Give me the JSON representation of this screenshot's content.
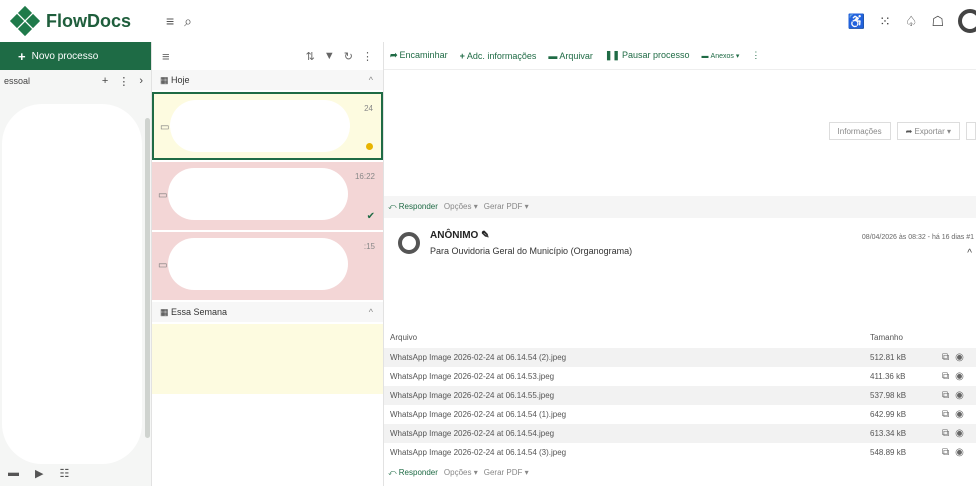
{
  "app": {
    "name": "FlowDocs"
  },
  "sidebar": {
    "new_process": "Novo processo",
    "section": "essoal"
  },
  "list": {
    "groups": [
      {
        "label": "Hoje"
      },
      {
        "label": "Essa Semana"
      }
    ],
    "cards": [
      {
        "time": "24"
      },
      {
        "time": "16:22"
      },
      {
        "time": ":15"
      }
    ]
  },
  "toolbar": {
    "forward": "Encaminhar",
    "add_info": "Adc. informações",
    "archive": "Arquivar",
    "pause": "Pausar processo",
    "attachments": "Anexos"
  },
  "detail": {
    "info_btn": "Informações",
    "export_btn": "Exportar",
    "reply": "Responder",
    "options": "Opções",
    "pdf": "Gerar PDF",
    "sender": "ANÔNIMO",
    "recipient": "Para Ouvidoria Geral do Município (Organograma)",
    "date": "08/04/2026 às 08:32 - há 16 dias #1"
  },
  "attachments": {
    "col_file": "Arquivo",
    "col_size": "Tamanho",
    "rows": [
      {
        "name": "WhatsApp Image 2026-02-24 at 06.14.54 (2).jpeg",
        "size": "512.81 kB"
      },
      {
        "name": "WhatsApp Image 2026-02-24 at 06.14.53.jpeg",
        "size": "411.36 kB"
      },
      {
        "name": "WhatsApp Image 2026-02-24 at 06.14.55.jpeg",
        "size": "537.98 kB"
      },
      {
        "name": "WhatsApp Image 2026-02-24 at 06.14.54 (1).jpeg",
        "size": "642.99 kB"
      },
      {
        "name": "WhatsApp Image 2026-02-24 at 06.14.54.jpeg",
        "size": "613.34 kB"
      },
      {
        "name": "WhatsApp Image 2026-02-24 at 06.14.54 (3).jpeg",
        "size": "548.89 kB"
      }
    ]
  }
}
